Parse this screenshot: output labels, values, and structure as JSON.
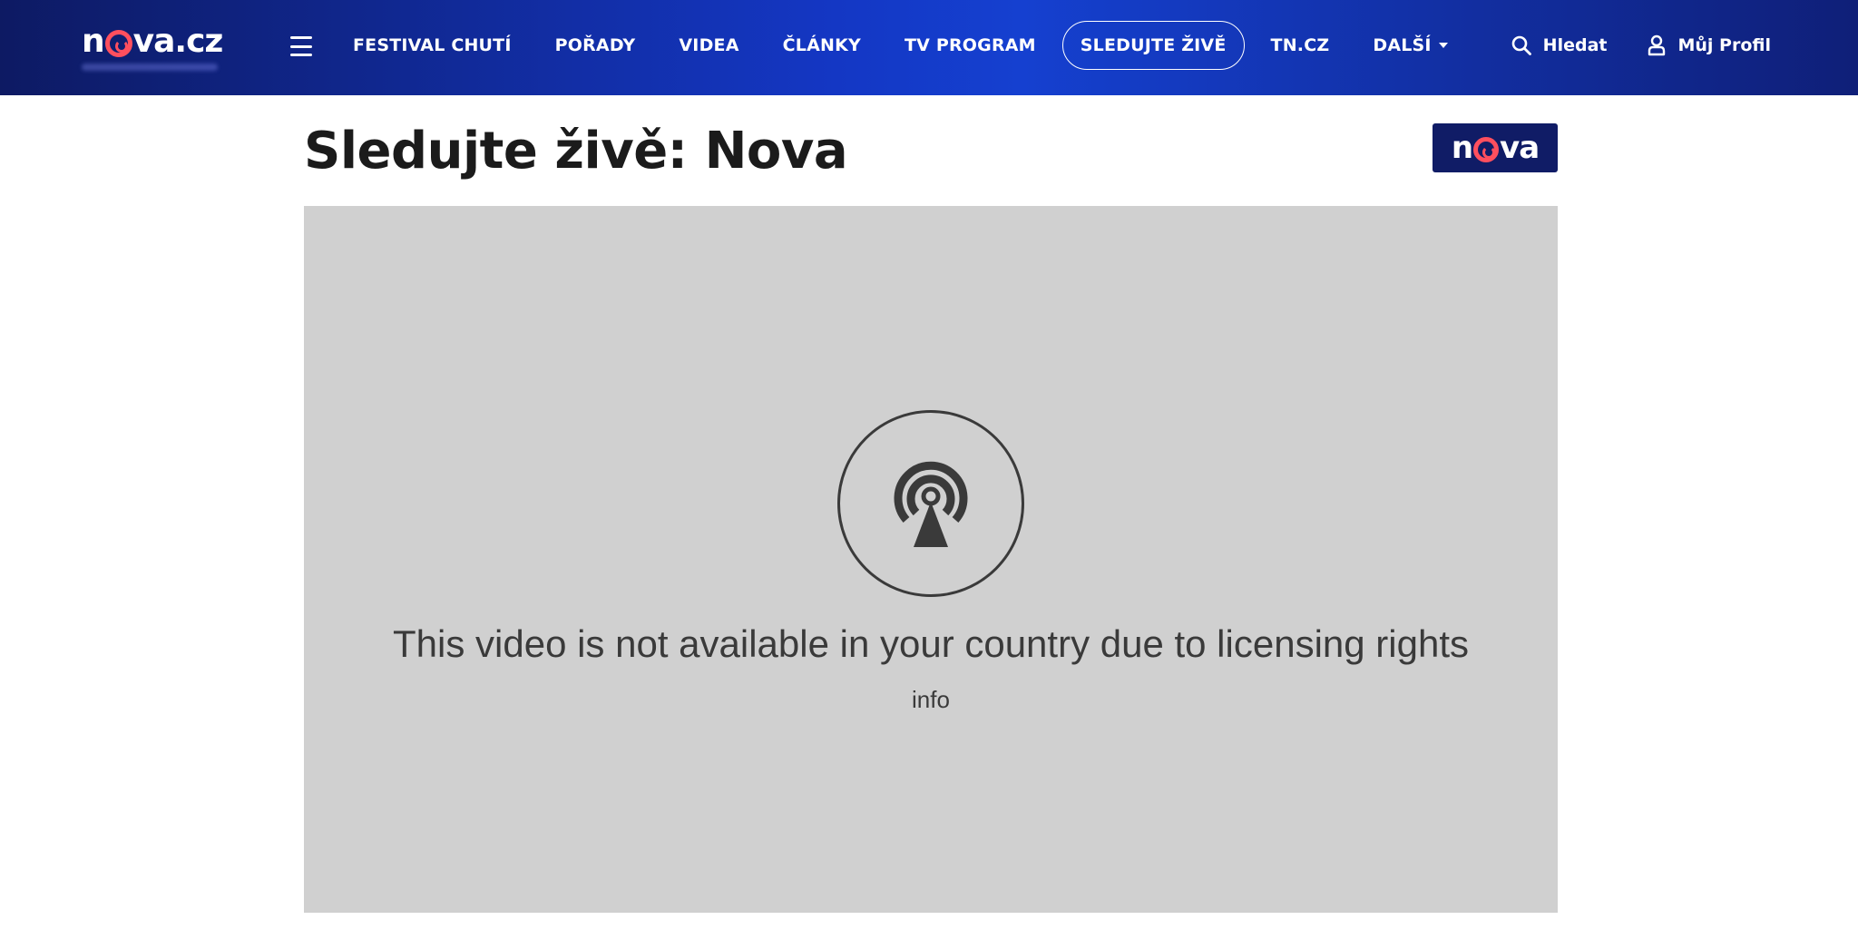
{
  "header": {
    "logo_left": "n",
    "logo_right": "va.cz",
    "nav": [
      {
        "label": "FESTIVAL CHUTÍ"
      },
      {
        "label": "POŘADY"
      },
      {
        "label": "VIDEA"
      },
      {
        "label": "ČLÁNKY"
      },
      {
        "label": "TV PROGRAM"
      },
      {
        "label": "SLEDUJTE ŽIVĚ",
        "active": true
      },
      {
        "label": "TN.CZ"
      },
      {
        "label": "DALŠÍ"
      }
    ],
    "search_label": "Hledat",
    "profile_label": "Můj Profil"
  },
  "main": {
    "title": "Sledujte živě: Nova",
    "badge_left": "n",
    "badge_right": "va"
  },
  "player": {
    "message": "This video is not available in your country due to licensing rights",
    "info": "info"
  },
  "colors": {
    "header_dark": "#0d1a63",
    "header_bright": "#1437c4",
    "accent_red": "#ff4f5e",
    "badge_bg": "#101c66",
    "player_bg": "#d0d0d0"
  },
  "icons": {
    "menu": "hamburger-icon",
    "search": "search-icon",
    "profile": "user-icon",
    "broadcast": "broadcast-icon"
  }
}
